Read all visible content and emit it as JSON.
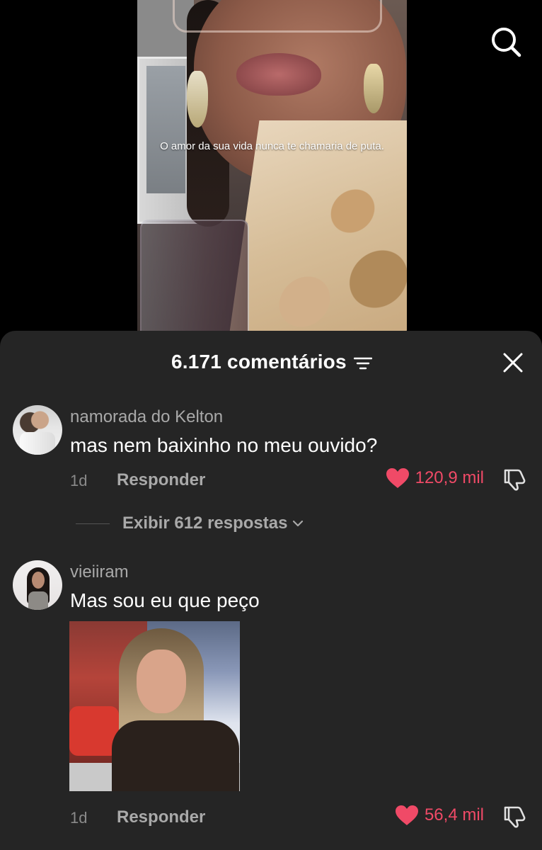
{
  "video": {
    "caption": "O amor da sua vida nunca te chamaria de puta."
  },
  "comments_sheet": {
    "title": "6.171 comentários",
    "comments": [
      {
        "username": "namorada do Kelton",
        "text": "mas nem baixinho no meu ouvido?",
        "time": "1d",
        "reply_label": "Responder",
        "likes": "120,9 mil",
        "replies_label": "Exibir 612 respostas"
      },
      {
        "username": "vieiiram",
        "text": "Mas sou eu que peço",
        "time": "1d",
        "reply_label": "Responder",
        "likes": "56,4 mil"
      }
    ]
  },
  "colors": {
    "sheet_bg": "#252525",
    "like_red": "#f04a67",
    "muted_text": "#a9a9a9"
  },
  "icons": [
    "search-icon",
    "filter-icon",
    "close-icon",
    "heart-icon",
    "dislike-icon",
    "chevron-down-icon"
  ]
}
